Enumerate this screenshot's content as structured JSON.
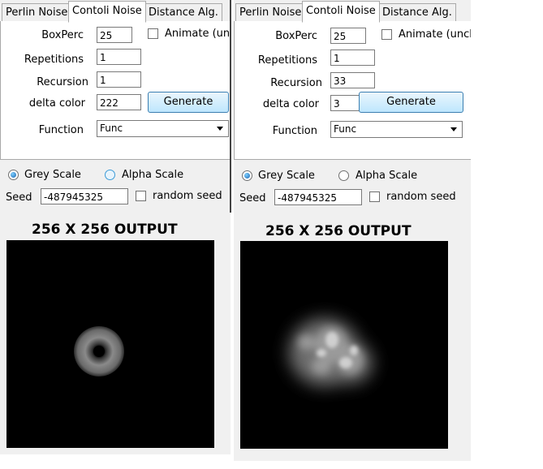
{
  "panels": [
    {
      "tabs": [
        "Perlin Noise",
        "Contoli Noise",
        "Distance Alg."
      ],
      "active_tab": 1,
      "fields": {
        "boxperc_label": "BoxPerc",
        "boxperc_value": "25",
        "animate_label": "Animate (unc",
        "repetitions_label": "Repetitions",
        "repetitions_value": "1",
        "recursion_label": "Recursion",
        "recursion_value": "1",
        "delta_label": "delta color",
        "delta_value": "222",
        "generate_label": "Generate",
        "function_label": "Function",
        "function_value": "Func"
      },
      "scale": {
        "grey_label": "Grey Scale",
        "alpha_label": "Alpha Scale",
        "selected": "grey"
      },
      "seed": {
        "label": "Seed",
        "value": "-487945325",
        "random_label": "random seed"
      },
      "output_title": "256 X 256 OUTPUT",
      "output_image": "ring"
    },
    {
      "tabs": [
        "Perlin Noise",
        "Contoli Noise",
        "Distance Alg."
      ],
      "active_tab": 1,
      "fields": {
        "boxperc_label": "BoxPerc",
        "boxperc_value": "25",
        "animate_label": "Animate (unch",
        "repetitions_label": "Repetitions",
        "repetitions_value": "1",
        "recursion_label": "Recursion",
        "recursion_value": "33",
        "delta_label": "delta color",
        "delta_value": "3",
        "generate_label": "Generate",
        "function_label": "Function",
        "function_value": "Func"
      },
      "scale": {
        "grey_label": "Grey Scale",
        "alpha_label": "Alpha Scale",
        "selected": "grey"
      },
      "seed": {
        "label": "Seed",
        "value": "-487945325",
        "random_label": "random seed"
      },
      "output_title": "256 X 256 OUTPUT",
      "output_image": "cloud"
    }
  ]
}
